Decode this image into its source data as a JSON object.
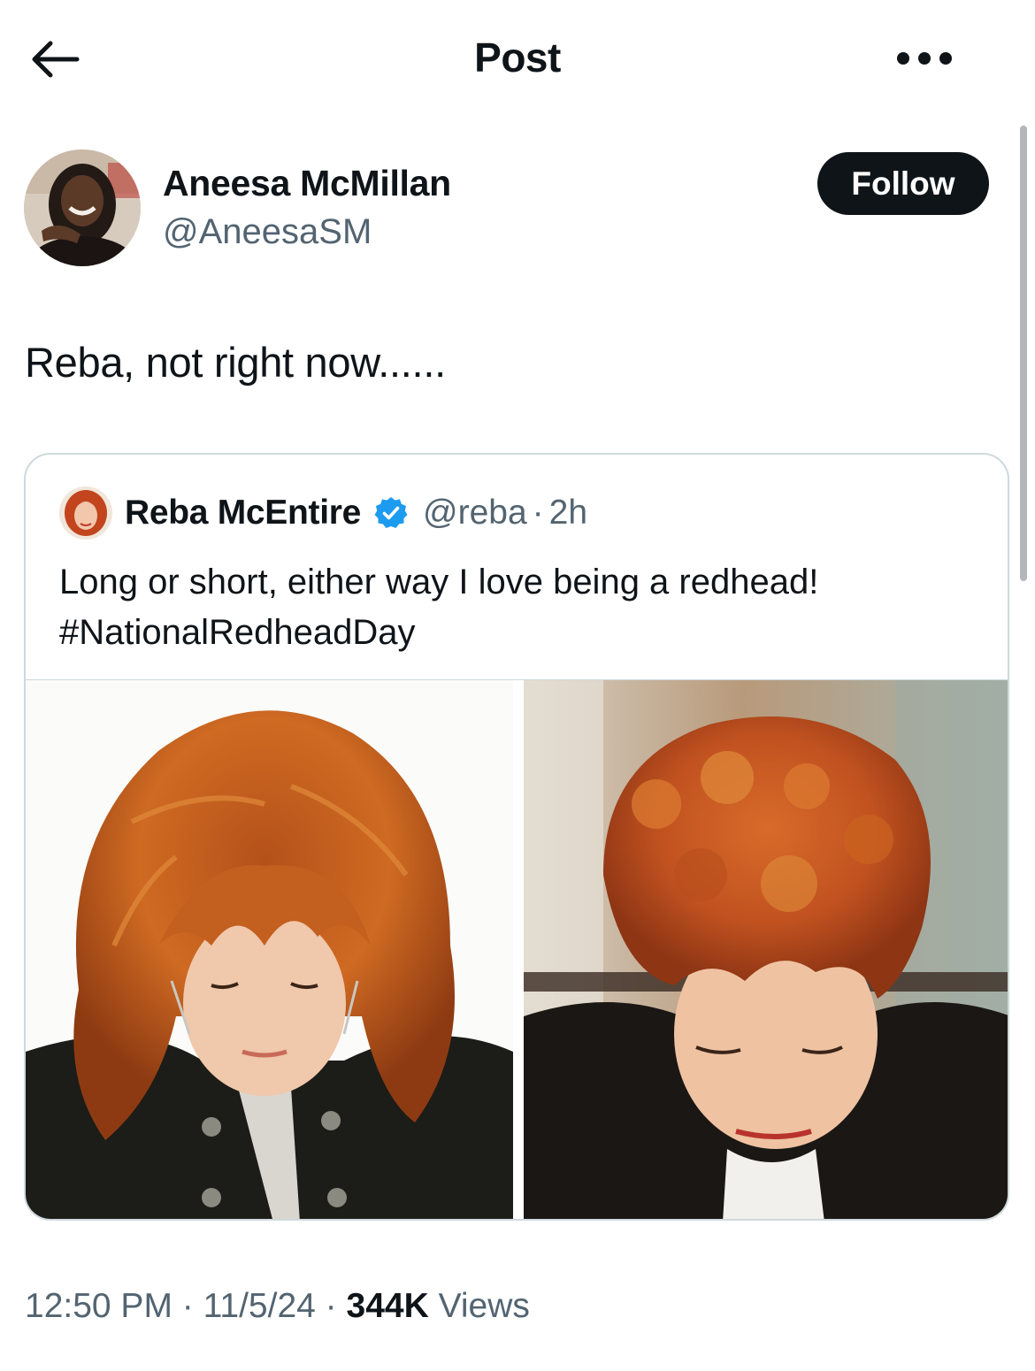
{
  "header": {
    "title": "Post",
    "back_icon": "arrow-left-icon",
    "more_icon": "more-horizontal-icon"
  },
  "author": {
    "name": "Aneesa McMillan",
    "handle": "@AneesaSM",
    "follow_label": "Follow"
  },
  "post": {
    "text": "Reba, not right now......"
  },
  "quote": {
    "name": "Reba McEntire",
    "verified": true,
    "handle": "@reba",
    "separator": "·",
    "time": "2h",
    "text_line1": "Long or short, either way I love being a redhead!",
    "text_line2": "#NationalRedheadDay",
    "media": [
      {
        "description_icon": "photo-long-red-hair"
      },
      {
        "description_icon": "photo-short-red-hair"
      }
    ]
  },
  "meta": {
    "time": "12:50 PM",
    "sep1": " · ",
    "date": "11/5/24",
    "sep2": " · ",
    "views_count": "344K",
    "views_label": " Views"
  },
  "colors": {
    "text_primary": "#0f1419",
    "text_secondary": "#536471",
    "border": "#cfd9de",
    "verified_blue": "#1d9bf0",
    "follow_bg": "#0f1419"
  }
}
